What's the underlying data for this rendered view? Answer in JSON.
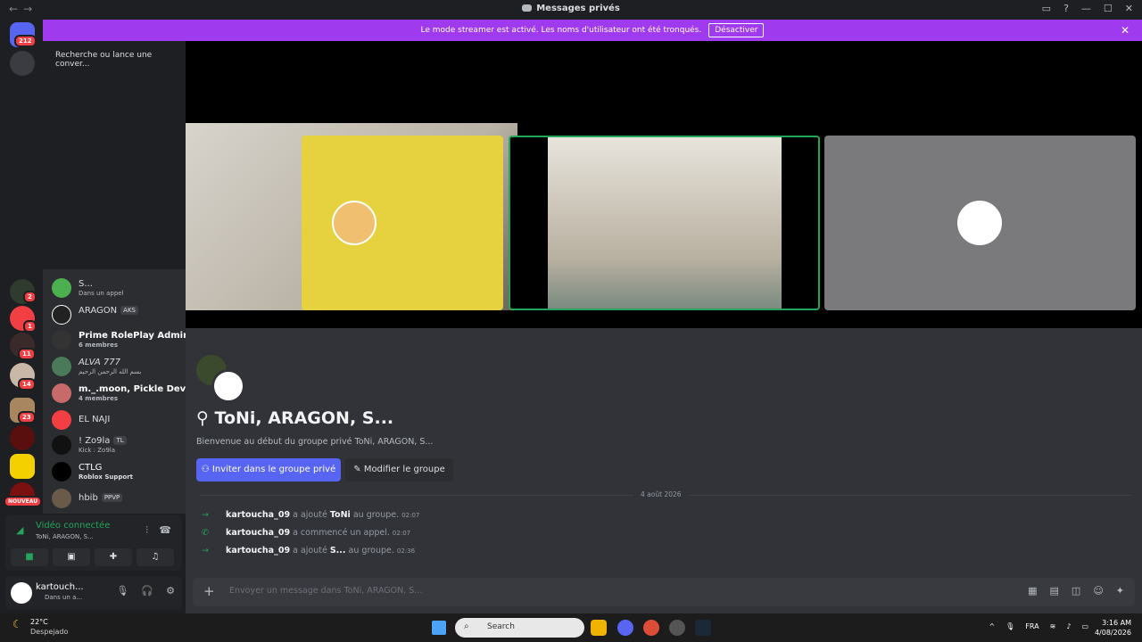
{
  "window": {
    "title": "Messages privés",
    "back_glyph": "←",
    "forward_glyph": "→"
  },
  "banner": {
    "text": "Le mode streamer est activé. Les noms d'utilisateur ont été tronqués.",
    "button": "Désactiver",
    "close_glyph": "✕"
  },
  "rail": {
    "home_badge": "212",
    "server_badges": [
      "2",
      "1",
      "11",
      "14",
      "23"
    ],
    "new_label": "NOUVEAU"
  },
  "search": {
    "placeholder": "Recherche ou lance une conver..."
  },
  "dms": [
    {
      "name": "S...",
      "sub": "Dans un appel",
      "tag": ""
    },
    {
      "name": "ARAGON",
      "sub": "",
      "tag": "AKS"
    },
    {
      "name": "Prime RolePlay Admin...",
      "sub": "6 membres",
      "tag": ""
    },
    {
      "name": "ALVA 777",
      "sub": "بسم الله الرحمن الرحيم",
      "tag": ""
    },
    {
      "name": "m._.moon, Pickle Devil...",
      "sub": "4 membres",
      "tag": ""
    },
    {
      "name": "EL NAJI",
      "sub": "",
      "tag": ""
    },
    {
      "name": "! Zo9la",
      "sub": "Kick : Zo9la",
      "tag": "TL"
    },
    {
      "name": "CTLG",
      "sub": "Roblox Support",
      "tag": ""
    },
    {
      "name": "hbib",
      "sub": "",
      "tag": "PPVP"
    }
  ],
  "voice": {
    "status": "Vidéo connectée",
    "channel": "ToNi, ARAGON, S..."
  },
  "user": {
    "name": "kartouch...",
    "status": "Dans un a..."
  },
  "group": {
    "title": "ToNi, ARAGON, S...",
    "welcome": "Bienvenue au début du groupe privé ToNi, ARAGON, S...",
    "invite_button": "Inviter dans le groupe privé",
    "edit_button": "Modifier le groupe",
    "date_divider": "4 août 2026"
  },
  "messages": [
    {
      "who": "kartoucha_09",
      "action": "a ajouté",
      "target": "ToNi",
      "suffix": "au groupe.",
      "time": "02:07"
    },
    {
      "who": "kartoucha_09",
      "action": "a commencé un appel.",
      "target": "",
      "suffix": "",
      "time": "02:07"
    },
    {
      "who": "kartoucha_09",
      "action": "a ajouté",
      "target": "S...",
      "suffix": "au groupe.",
      "time": "02:36"
    }
  ],
  "composer": {
    "placeholder": "Envoyer un message dans ToNi, ARAGON, S..."
  },
  "taskbar": {
    "temp": "22°C",
    "weather": "Despejado",
    "search": "Search",
    "lang": "FRA",
    "time": "3:16 AM",
    "date": "4/08/2026"
  },
  "colors": {
    "accent": "#5865f2",
    "streamer_banner": "#a03aef",
    "online_green": "#23a55a",
    "badge_red": "#f23f43"
  }
}
